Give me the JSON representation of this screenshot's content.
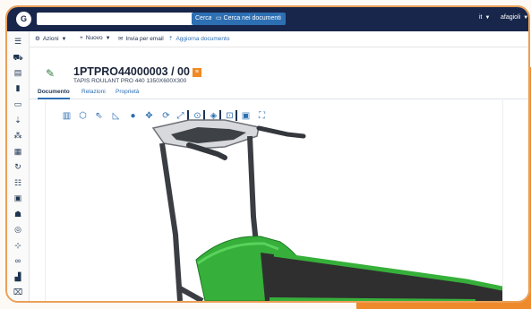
{
  "topbar": {
    "logo_text": "G",
    "search_value": "",
    "search_button": "Cerca",
    "search_docs_button": "Cerca nei documenti",
    "language": "it",
    "user": "afagioli"
  },
  "sidebar": {
    "icons": [
      "cart-icon",
      "document-icon",
      "bar-icon",
      "folder-icon",
      "person-down-icon",
      "hierarchy-icon",
      "grid-icon",
      "cycle-icon",
      "list-icon",
      "calendar-icon",
      "team-icon",
      "layers-icon",
      "filter-icon",
      "link-icon",
      "chart-icon",
      "trash-icon",
      "copy-icon"
    ]
  },
  "toolbar": {
    "actions": "Azioni",
    "new": "Nuovo",
    "send_email": "Invia per email",
    "update_doc": "Aggiorna documento"
  },
  "header": {
    "title": "1PTPRO44000003 / 00",
    "subtitle": "TAPIS ROULANT PRO 440 1350X600X300",
    "badge_icon": "notes-icon"
  },
  "tabs": [
    {
      "label": "Documento"
    },
    {
      "label": "Relazioni"
    },
    {
      "label": "Proprietà"
    }
  ],
  "viewer": {
    "tools": [
      "clipboard-icon",
      "cube-icon",
      "select-icon",
      "measure-icon",
      "comment-icon",
      "move-icon",
      "rotate-icon",
      "resize-icon",
      "explode-icon",
      "orbit-icon",
      "box-icon",
      "section-icon",
      "camera-icon",
      "fullscreen-icon"
    ],
    "colors": {
      "frame": "#3a3d42",
      "belt": "#2f2f2f",
      "green": "#36b03a",
      "console": "#d7d9dc"
    }
  }
}
